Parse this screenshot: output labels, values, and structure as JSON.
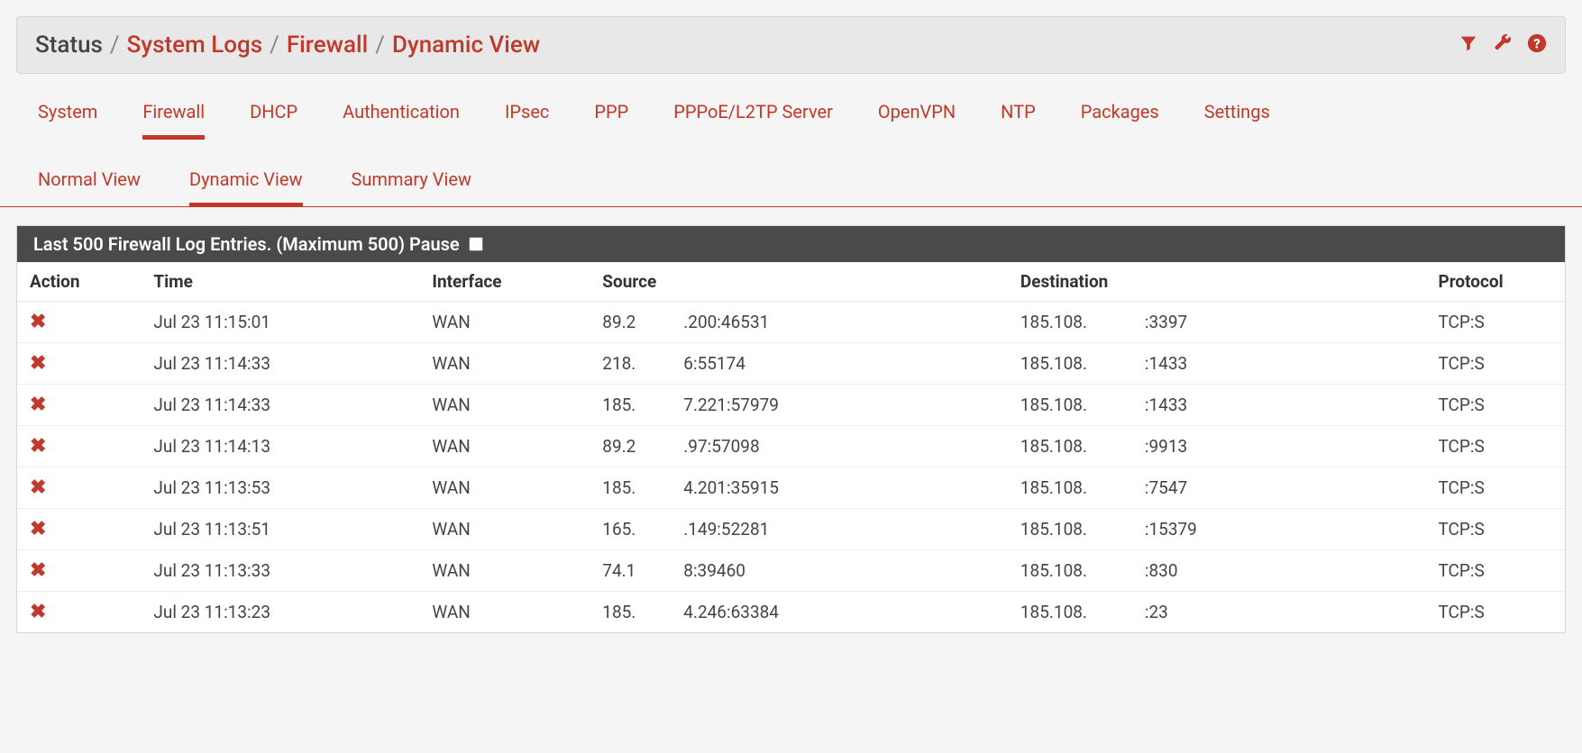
{
  "breadcrumb": {
    "status": "Status",
    "systemLogs": "System Logs",
    "firewall": "Firewall",
    "dynamicView": "Dynamic View",
    "sep": "/"
  },
  "icons": {
    "filter": "filter-icon",
    "wrench": "wrench-icon",
    "help": "help-icon"
  },
  "tabs": [
    "System",
    "Firewall",
    "DHCP",
    "Authentication",
    "IPsec",
    "PPP",
    "PPPoE/L2TP Server",
    "OpenVPN",
    "NTP",
    "Packages",
    "Settings"
  ],
  "activeTab": "Firewall",
  "subtabs": [
    "Normal View",
    "Dynamic View",
    "Summary View"
  ],
  "activeSubtab": "Dynamic View",
  "panel": {
    "title": "Last 500 Firewall Log Entries. (Maximum 500) Pause",
    "pauseChecked": false
  },
  "columns": {
    "action": "Action",
    "time": "Time",
    "interface": "Interface",
    "source": "Source",
    "destination": "Destination",
    "protocol": "Protocol"
  },
  "rows": [
    {
      "time": "Jul 23 11:15:01",
      "interface": "WAN",
      "src_a": "89.2",
      "src_b": ".200:46531",
      "dst_a": "185.108.",
      "dst_b": ":3397",
      "proto": "TCP:S"
    },
    {
      "time": "Jul 23 11:14:33",
      "interface": "WAN",
      "src_a": "218.",
      "src_b": "6:55174",
      "dst_a": "185.108.",
      "dst_b": ":1433",
      "proto": "TCP:S"
    },
    {
      "time": "Jul 23 11:14:33",
      "interface": "WAN",
      "src_a": "185.",
      "src_b": "7.221:57979",
      "dst_a": "185.108.",
      "dst_b": ":1433",
      "proto": "TCP:S"
    },
    {
      "time": "Jul 23 11:14:13",
      "interface": "WAN",
      "src_a": "89.2",
      "src_b": ".97:57098",
      "dst_a": "185.108.",
      "dst_b": ":9913",
      "proto": "TCP:S"
    },
    {
      "time": "Jul 23 11:13:53",
      "interface": "WAN",
      "src_a": "185.",
      "src_b": "4.201:35915",
      "dst_a": "185.108.",
      "dst_b": ":7547",
      "proto": "TCP:S"
    },
    {
      "time": "Jul 23 11:13:51",
      "interface": "WAN",
      "src_a": "165.",
      "src_b": ".149:52281",
      "dst_a": "185.108.",
      "dst_b": ":15379",
      "proto": "TCP:S"
    },
    {
      "time": "Jul 23 11:13:33",
      "interface": "WAN",
      "src_a": "74.1",
      "src_b": "8:39460",
      "dst_a": "185.108.",
      "dst_b": ":830",
      "proto": "TCP:S"
    },
    {
      "time": "Jul 23 11:13:23",
      "interface": "WAN",
      "src_a": "185.",
      "src_b": "4.246:63384",
      "dst_a": "185.108.",
      "dst_b": ":23",
      "proto": "TCP:S"
    }
  ]
}
